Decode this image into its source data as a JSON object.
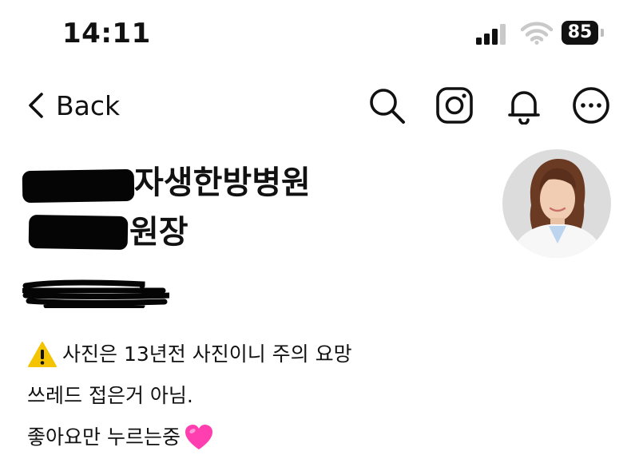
{
  "status_bar": {
    "time": "14:11",
    "battery": "85",
    "icons": [
      "signal-bars-icon",
      "wifi-icon",
      "battery-icon"
    ]
  },
  "nav": {
    "back_label": "Back",
    "icons": [
      "search-icon",
      "instagram-icon",
      "bell-icon",
      "more-icon"
    ]
  },
  "profile": {
    "name_line1": "자생한방병원",
    "name_line2": "원장",
    "handle_redacted": true
  },
  "bio": {
    "line1": "사진은 13년전 사진이니 주의 요망",
    "line2": "쓰레드 접은거 아님.",
    "line3": "좋아요만 누르는중",
    "warning_icon": "warning-icon",
    "heart_icon": "pink-heart-icon"
  },
  "colors": {
    "text": "#111111",
    "background": "#ffffff",
    "warning": "#f5c400",
    "heart": "#ff3fb0"
  }
}
